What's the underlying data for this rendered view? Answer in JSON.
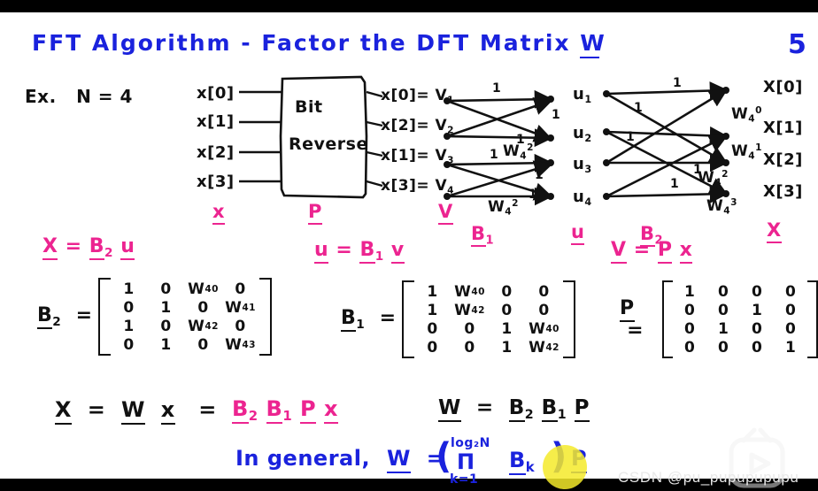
{
  "page": {
    "number": "5",
    "background": "#ffffff",
    "letterbox": "#000000"
  },
  "colors": {
    "blue": "#1a22dd",
    "black": "#111111",
    "magenta": "#ec2490",
    "highlight": "#f5ea2a"
  },
  "header": {
    "title": "FFT Algorithm - Factor the DFT Matrix W",
    "title_underlined_token": "W"
  },
  "example": {
    "label": "Ex.",
    "statement": "N = 4"
  },
  "flowgraph": {
    "inputs": [
      "x[0]",
      "x[1]",
      "x[2]",
      "x[3]"
    ],
    "input_vector_label": "x",
    "block": {
      "line1": "Bit",
      "line2": "Reverse",
      "label": "P"
    },
    "bitreverse_outputs": [
      {
        "text": "x[0]= V",
        "index": "1"
      },
      {
        "text": "x[2]= V",
        "index": "2"
      },
      {
        "text": "x[1]= V",
        "index": "3"
      },
      {
        "text": "x[3]= V",
        "index": "4"
      }
    ],
    "v_vector_label": "V",
    "stage1": {
      "label": "B",
      "label_sub": "1",
      "edge_weights": [
        "1",
        "1",
        "1",
        "1"
      ],
      "twiddles": [
        {
          "base": "W",
          "sub": "4",
          "sup": "2"
        },
        {
          "base": "W",
          "sub": "4",
          "sup": "2"
        }
      ]
    },
    "u_nodes": [
      {
        "base": "u",
        "sub": "1"
      },
      {
        "base": "u",
        "sub": "2"
      },
      {
        "base": "u",
        "sub": "3"
      },
      {
        "base": "u",
        "sub": "4"
      }
    ],
    "u_vector_label": "u",
    "stage2": {
      "label": "B",
      "label_sub": "2",
      "edge_weights": [
        "1",
        "1",
        "1",
        "1"
      ],
      "twiddles": [
        {
          "base": "W",
          "sub": "4",
          "sup": "0"
        },
        {
          "base": "W",
          "sub": "4",
          "sup": "1"
        },
        {
          "base": "W",
          "sub": "4",
          "sup": "2"
        },
        {
          "base": "W",
          "sub": "4",
          "sup": "3"
        }
      ]
    },
    "outputs": [
      "X[0]",
      "X[1]",
      "X[2]",
      "X[3]"
    ],
    "output_vector_label": "X"
  },
  "equations": {
    "eq_b2": {
      "lhs": "X",
      "op": "=",
      "rhs1": "B",
      "rhs1_sub": "2",
      "rhs2": "u"
    },
    "eq_b1": {
      "lhs": "u",
      "op": "=",
      "rhs1": "B",
      "rhs1_sub": "1",
      "rhs2": "v"
    },
    "eq_p": {
      "lhs": "V",
      "op": "=",
      "rhs1": "P",
      "rhs2": "x"
    },
    "summary_black": "X  =  W x   =",
    "summary_magenta": "B₂ B₁ P x",
    "w_identity": "W  =  B₂ B₁ P",
    "general": {
      "prefix": "In general,",
      "lhs": "W",
      "eq": "=",
      "open_paren": "(",
      "product_top": "log₂N",
      "product_symbol": "Π",
      "product_bottom": "k=1",
      "product_term": "B",
      "product_term_sub": "k",
      "close_paren": ")",
      "suffix": "P"
    }
  },
  "matrices": {
    "B2": {
      "name": "B",
      "name_sub": "2",
      "rows": [
        [
          "1",
          "0",
          {
            "base": "W",
            "sub": "4",
            "sup": "0"
          },
          "0"
        ],
        [
          "0",
          "1",
          "0",
          {
            "base": "W",
            "sub": "4",
            "sup": "1"
          }
        ],
        [
          "1",
          "0",
          {
            "base": "W",
            "sub": "4",
            "sup": "2"
          },
          "0"
        ],
        [
          "0",
          "1",
          "0",
          {
            "base": "W",
            "sub": "4",
            "sup": "3"
          }
        ]
      ]
    },
    "B1": {
      "name": "B",
      "name_sub": "1",
      "rows": [
        [
          "1",
          {
            "base": "W",
            "sub": "4",
            "sup": "0"
          },
          "0",
          "0"
        ],
        [
          "1",
          {
            "base": "W",
            "sub": "4",
            "sup": "2"
          },
          "0",
          "0"
        ],
        [
          "0",
          "0",
          "1",
          {
            "base": "W",
            "sub": "4",
            "sup": "0"
          }
        ],
        [
          "0",
          "0",
          "1",
          {
            "base": "W",
            "sub": "4",
            "sup": "2"
          }
        ]
      ]
    },
    "P": {
      "name": "P",
      "name_sub": "",
      "rows": [
        [
          "1",
          "0",
          "0",
          "0"
        ],
        [
          "0",
          "0",
          "1",
          "0"
        ],
        [
          "0",
          "1",
          "0",
          "0"
        ],
        [
          "0",
          "0",
          "0",
          "1"
        ]
      ]
    }
  },
  "watermark": {
    "text": "CSDN @pu_pupupupupu",
    "icon": "tv-play-icon"
  }
}
